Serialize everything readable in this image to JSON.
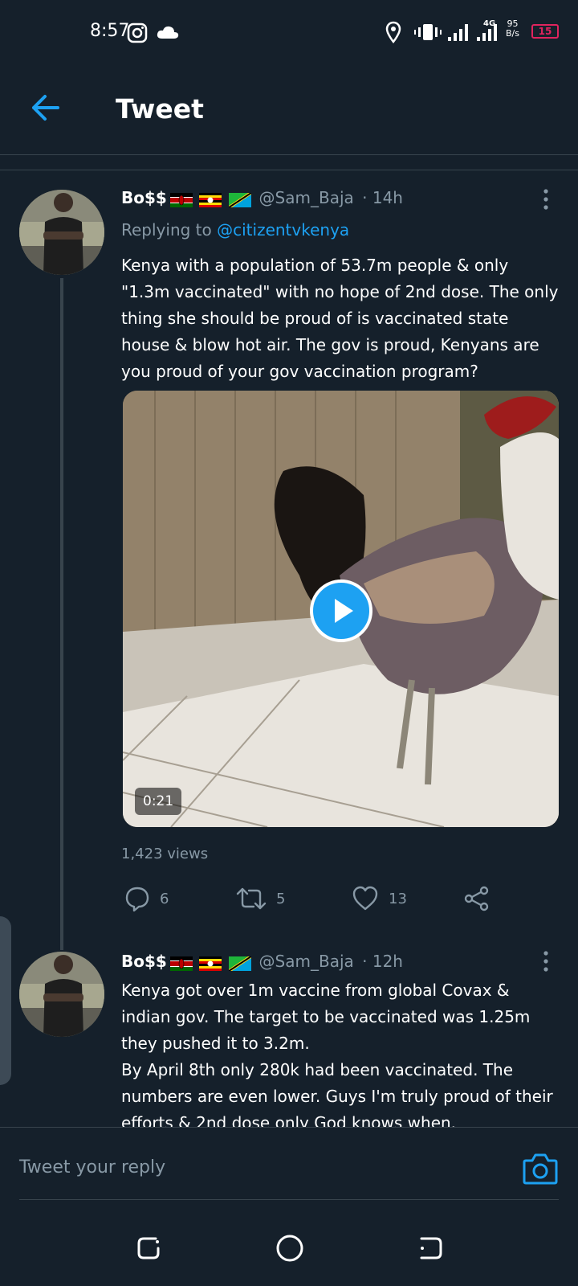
{
  "status_bar": {
    "time": "8:57",
    "network": "4G",
    "speed_value": "95",
    "speed_unit": "B/s",
    "battery": "15"
  },
  "header": {
    "title": "Tweet"
  },
  "tweets": [
    {
      "name": "Bo$$",
      "handle": "@Sam_Baja",
      "time": "· 14h",
      "replying_label": "Replying to",
      "replying_to": "@citizentvkenya",
      "text": "Kenya with a population of 53.7m people & only \"1.3m vaccinated\" with no hope of 2nd dose. The only thing she should be proud of is vaccinated state house & blow hot air. The gov is proud, Kenyans are you proud of your gov vaccination program?",
      "video_duration": "0:21",
      "views": "1,423 views",
      "replies": "6",
      "retweets": "5",
      "likes": "13"
    },
    {
      "name": "Bo$$",
      "handle": "@Sam_Baja",
      "time": "· 12h",
      "text_lines": [
        "Kenya got over 1m vaccine from global Covax & indian gov. The target to be vaccinated was 1.25m they pushed it to 3.2m.",
        "By April 8th only 280k had been vaccinated. The numbers are even lower. Guys I'm truly proud of their efforts & 2nd dose only God knows when."
      ]
    }
  ],
  "reply_box": {
    "placeholder": "Tweet your reply"
  },
  "colors": {
    "background": "#15202b",
    "accent": "#1da1f2",
    "secondary_text": "#8899a6",
    "divider": "#38444d"
  }
}
